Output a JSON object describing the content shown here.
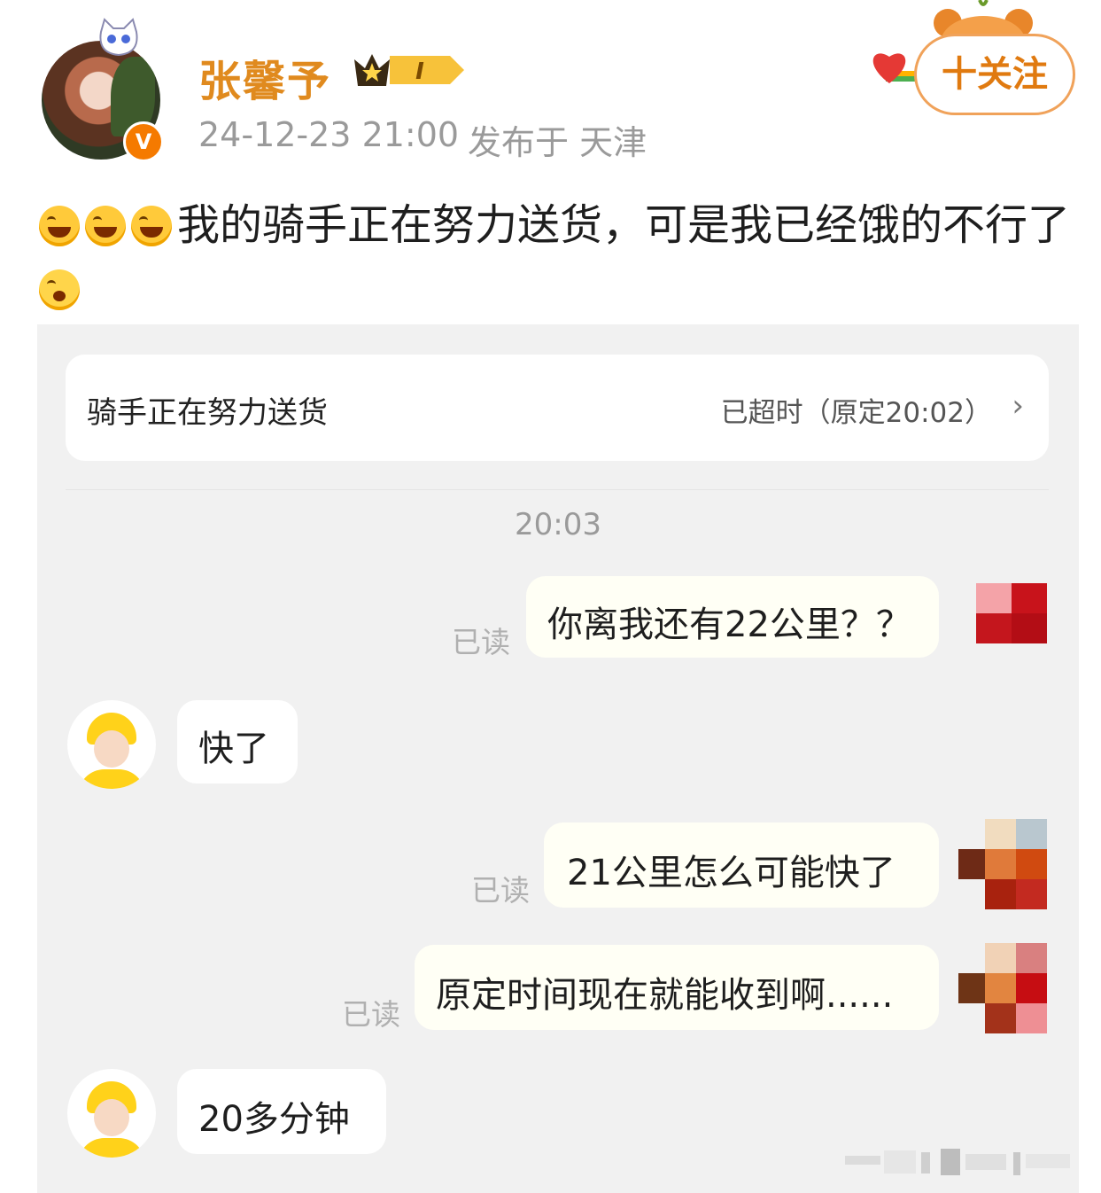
{
  "post": {
    "username": "张馨予",
    "level_badge": "I",
    "verified_badge": "V",
    "time": "24-12-23 21:00",
    "location": "发布于 天津",
    "follow_label": "十关注",
    "text": "我的骑手正在努力送货，可是我已经饿的不行了",
    "leading_emojis": [
      "laugh-cry-emoji",
      "laugh-cry-emoji",
      "laugh-cry-emoji"
    ],
    "trailing_emoji": "crying-emoji"
  },
  "screenshot": {
    "order_status": "骑手正在努力送货",
    "order_timeout": "已超时（原定20:02）",
    "arrow": "›",
    "chat_time": "20:03",
    "messages": [
      {
        "sender": "me",
        "text": "你离我还有22公里？？",
        "read": "已读"
      },
      {
        "sender": "rider",
        "text": "快了"
      },
      {
        "sender": "me",
        "text": "21公里怎么可能快了",
        "read": "已读"
      },
      {
        "sender": "me",
        "text": "原定时间现在就能收到啊......",
        "read": "已读"
      },
      {
        "sender": "rider",
        "text": "20多分钟"
      }
    ]
  },
  "colors": {
    "username": "#e08a1e",
    "follow_border": "#f0a25a",
    "chat_background": "#f1f1f1",
    "my_bubble": "#fffff5",
    "rider_helmet": "#ffd21a"
  },
  "icons": [
    "cat-icon",
    "vip-level-icon",
    "verified-v-icon",
    "heart-icon",
    "bear-icon",
    "chevron-right-icon",
    "rider-avatar-icon",
    "pixelated-avatar"
  ]
}
